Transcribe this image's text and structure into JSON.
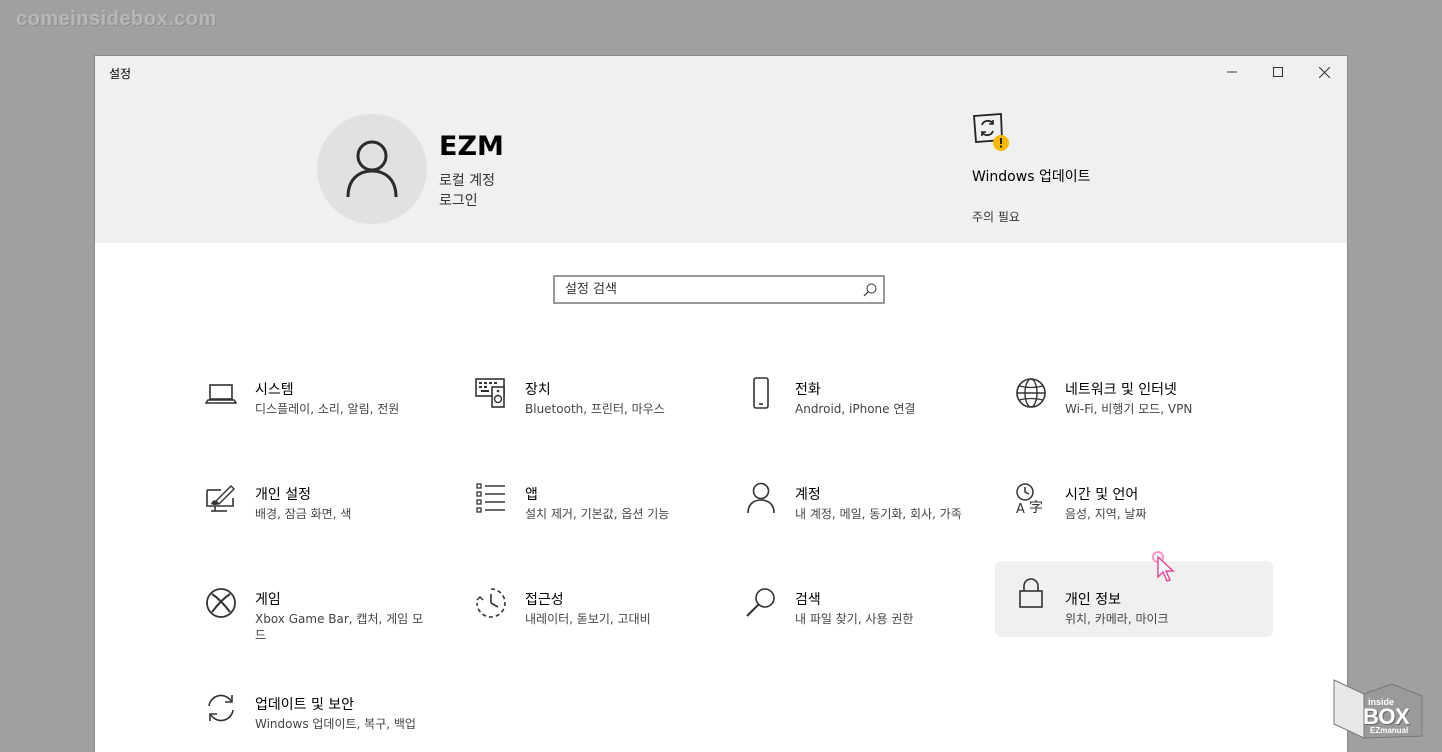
{
  "watermark": "comeinsidebox.com",
  "window": {
    "title": "설정",
    "controls": [
      "minimize-icon",
      "maximize-icon",
      "close-icon"
    ]
  },
  "header": {
    "user_name": "EZM",
    "account_type": "로컬 계정",
    "signin_link": "로그인",
    "update": {
      "title": "Windows 업데이트",
      "status": "주의 필요",
      "icon": "windows-update-warning-icon",
      "warning_color": "#f8b900"
    }
  },
  "search": {
    "placeholder": "설정 검색",
    "value": ""
  },
  "tiles": [
    {
      "title": "시스템",
      "subtitle": "디스플레이, 소리, 알림, 전원",
      "icon": "laptop-icon"
    },
    {
      "title": "장치",
      "subtitle": "Bluetooth, 프린터, 마우스",
      "icon": "keyboard-speaker-icon"
    },
    {
      "title": "전화",
      "subtitle": "Android, iPhone 연결",
      "icon": "phone-icon"
    },
    {
      "title": "네트워크 및 인터넷",
      "subtitle": "Wi-Fi, 비행기 모드, VPN",
      "icon": "globe-icon"
    },
    {
      "title": "개인 설정",
      "subtitle": "배경, 잠금 화면, 색",
      "icon": "paint-monitor-icon"
    },
    {
      "title": "앱",
      "subtitle": "설치 제거, 기본값, 옵션 기능",
      "icon": "apps-list-icon"
    },
    {
      "title": "계정",
      "subtitle": "내 계정, 메일, 동기화, 회사, 가족",
      "icon": "person-icon"
    },
    {
      "title": "시간 및 언어",
      "subtitle": "음성, 지역, 날짜",
      "icon": "time-language-icon"
    },
    {
      "title": "게임",
      "subtitle": "Xbox Game Bar, 캡처, 게임 모드",
      "icon": "xbox-icon"
    },
    {
      "title": "접근성",
      "subtitle": "내레이터, 돋보기, 고대비",
      "icon": "ease-of-access-icon"
    },
    {
      "title": "검색",
      "subtitle": "내 파일 찾기, 사용 권한",
      "icon": "magnifier-icon"
    },
    {
      "title": "개인 정보",
      "subtitle": "위치, 카메라, 마이크",
      "icon": "lock-icon"
    },
    {
      "title": "업데이트 및 보안",
      "subtitle": "Windows 업데이트, 복구, 백업",
      "icon": "sync-arrows-icon"
    }
  ],
  "logo": {
    "top": "inside",
    "main": "BOX",
    "bottom": "EZmanual"
  },
  "colors": {
    "header_bg": "#f0f0f0",
    "hover_bg": "#f0f0f0",
    "cursor_color": "#ff69b4"
  }
}
